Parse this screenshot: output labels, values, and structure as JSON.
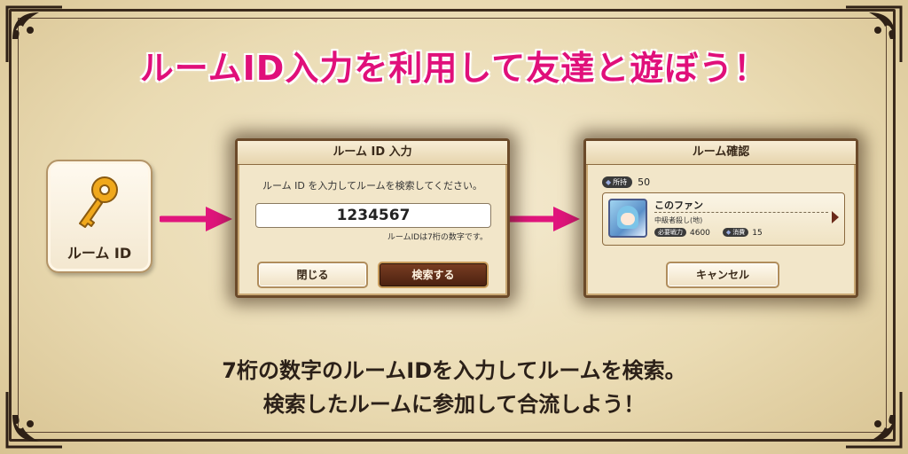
{
  "headline": "ルームID入力を利用して友達と遊ぼう！",
  "key_button": {
    "label": "ルーム ID",
    "icon": "key-icon"
  },
  "input_dialog": {
    "title": "ルーム ID 入力",
    "prompt": "ルーム ID を入力してルームを検索してください。",
    "id_value": "1234567",
    "hint": "ルームIDは7桁の数字です。",
    "close_label": "閉じる",
    "search_label": "検索する"
  },
  "confirm_dialog": {
    "title": "ルーム確認",
    "owned_label": "所持",
    "owned_value": "50",
    "room": {
      "name": "このファン",
      "stage": "中級者殺し(地)",
      "power_label": "必要戦力",
      "power_value": "4600",
      "cost_label": "消費",
      "cost_value": "15"
    },
    "cancel_label": "キャンセル"
  },
  "caption": {
    "line1": "7桁の数字のルームIDを入力してルームを検索。",
    "line2": "検索したルームに参加して合流しよう！"
  },
  "colors": {
    "headline": "#e0107a",
    "arrow": "#e0157c",
    "frame": "#3b2a1c"
  }
}
